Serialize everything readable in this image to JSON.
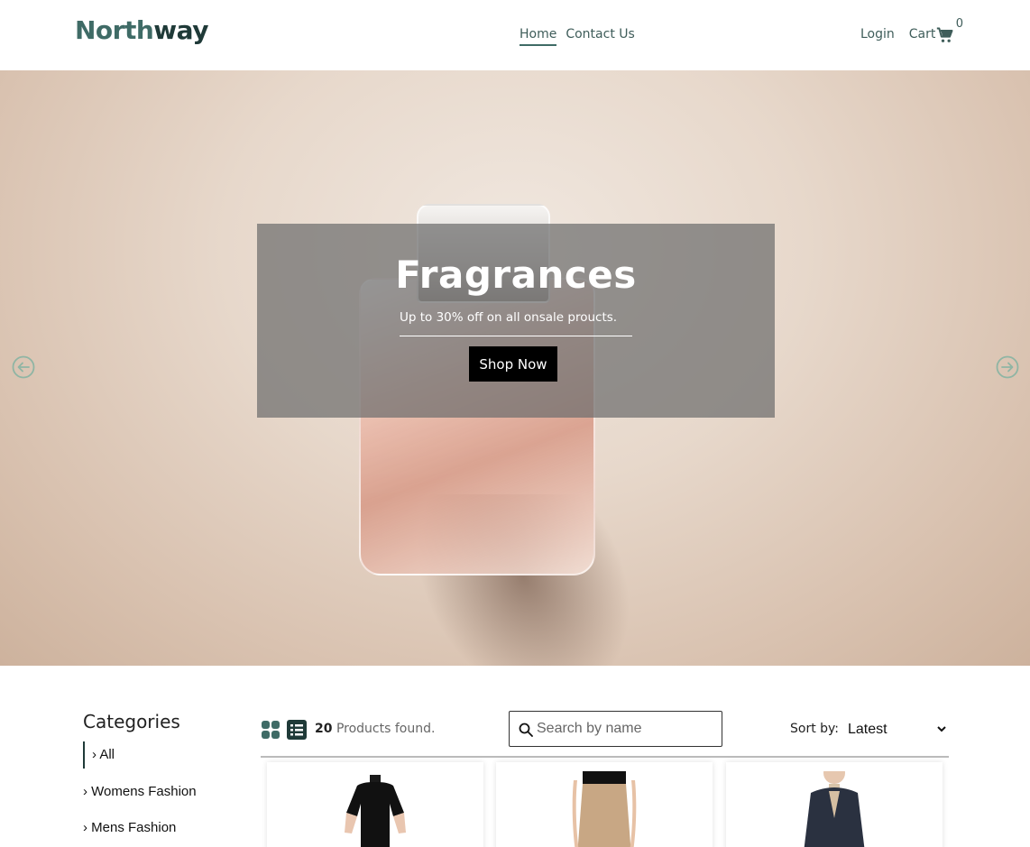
{
  "header": {
    "logo_part1": "North",
    "logo_part2": "way",
    "nav": {
      "home": "Home",
      "contact": "Contact Us"
    },
    "login": "Login",
    "cart_label": "Cart",
    "cart_count": "0"
  },
  "hero": {
    "title": "Fragrances",
    "subtitle": "Up to 30% off on all onsale proucts.",
    "button": "Shop Now",
    "prev_icon": "arrow-left-circle-icon",
    "next_icon": "arrow-right-circle-icon"
  },
  "categories": {
    "title": "Categories",
    "items": [
      {
        "label": "› All",
        "active": true
      },
      {
        "label": "› Womens Fashion",
        "active": false
      },
      {
        "label": "› Mens Fashion",
        "active": false
      }
    ]
  },
  "products": {
    "count": "20",
    "count_suffix": "Products found.",
    "search_placeholder": "Search by name",
    "sort_label": "Sort by:",
    "sort_selected": "Latest",
    "view_icons": [
      "grid-view-icon",
      "list-view-icon"
    ]
  },
  "colors": {
    "brand": "#3f6b66",
    "brand_dark": "#1f3a38",
    "button": "#000000"
  }
}
